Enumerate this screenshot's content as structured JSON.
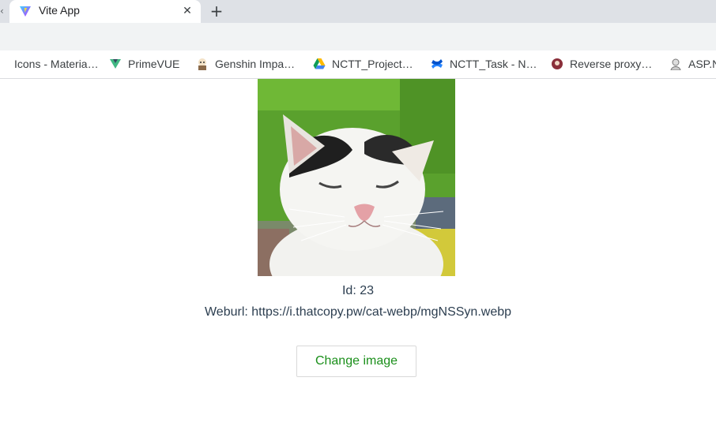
{
  "browser": {
    "tab": {
      "title": "Vite App",
      "close_glyph": "✕",
      "favicon": "vite-logo-icon"
    },
    "new_tab_glyph": "+",
    "left_fragment_glyph": "‹",
    "bookmarks": [
      {
        "label": "Icons - Materia…",
        "icon": "material-icon"
      },
      {
        "label": "PrimeVUE",
        "icon": "primevue-logo-icon"
      },
      {
        "label": "Genshin Impa…",
        "icon": "genshin-icon"
      },
      {
        "label": "NCTT_Project…",
        "icon": "google-drive-icon"
      },
      {
        "label": "NCTT_Task - N…",
        "icon": "confluence-icon"
      },
      {
        "label": "Reverse proxy…",
        "icon": "nginx-avatar-icon"
      },
      {
        "label": "ASP.N",
        "icon": "aspnet-avatar-icon"
      }
    ]
  },
  "main": {
    "image_alt": "cat",
    "id_text": "Id: 23",
    "weburl_text": "Weburl: https://i.thatcopy.pw/cat-webp/mgNSSyn.webp",
    "change_button_label": "Change image"
  },
  "colors": {
    "button_text": "#1a8f1a",
    "tabstrip_bg": "#dee1e6",
    "toolbar_bg": "#f1f3f4"
  }
}
